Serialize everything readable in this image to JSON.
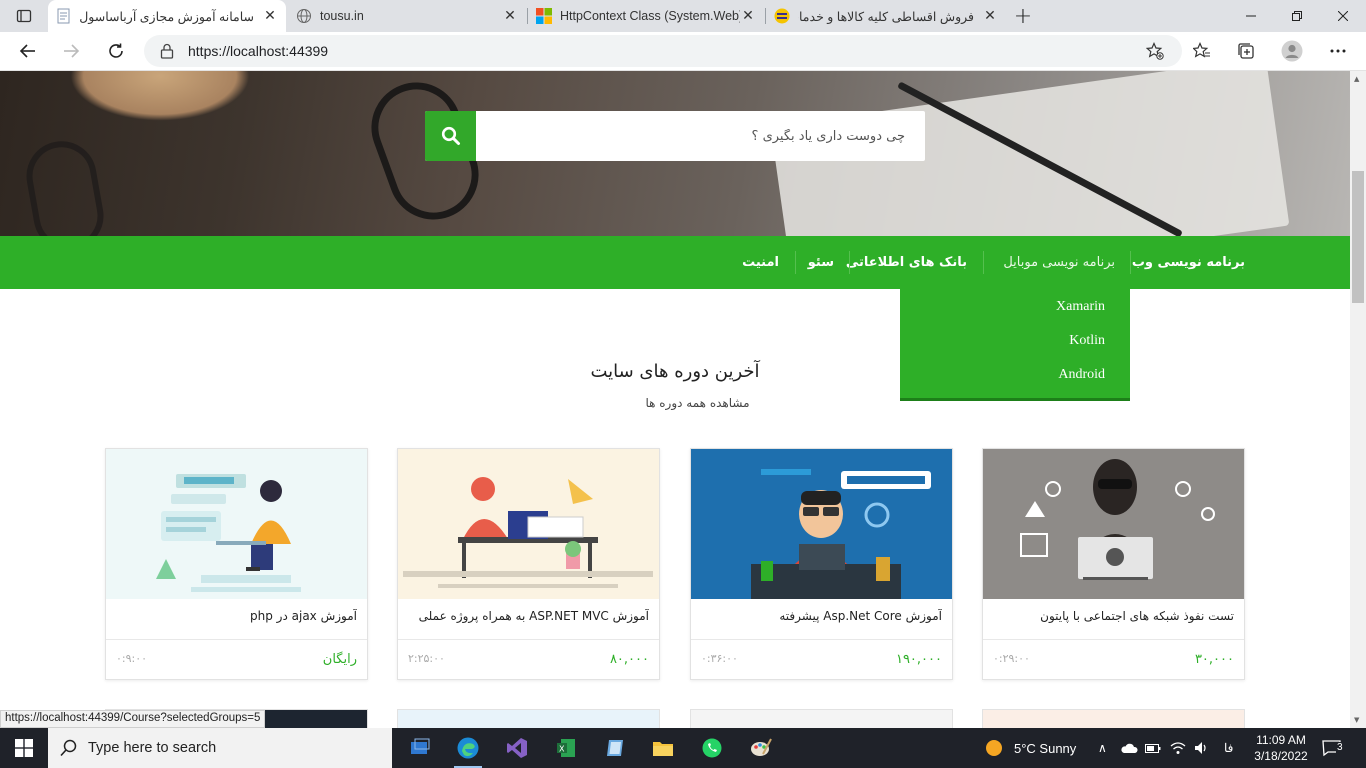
{
  "browser": {
    "tabs": [
      {
        "title": "سامانه آموزش مجازی آرباساسول",
        "active": true
      },
      {
        "title": "tousu.in",
        "active": false
      },
      {
        "title": "HttpContext Class (System.Web)",
        "active": false
      },
      {
        "title": "فروش اقساطی کلیه کالاها و خدمات",
        "active": false
      }
    ],
    "url": "https://localhost:44399",
    "status_url": "https://localhost:44399/Course?selectedGroups=5"
  },
  "site": {
    "search_placeholder": "چی دوست داری یاد بگیری ؟",
    "menu": [
      {
        "label": "برنامه نویسی وب"
      },
      {
        "label": "برنامه نویسی موبایل"
      },
      {
        "label": "بانک های اطلاعاتی"
      },
      {
        "label": "سئو"
      },
      {
        "label": "امنیت"
      }
    ],
    "dropdown": [
      "Xamarin",
      "Kotlin",
      "Android"
    ],
    "section_title": "آخرین دوره های سایت",
    "section_link": "مشاهده همه دوره ها",
    "courses": [
      {
        "title": "تست نفوذ شبکه های اجتماعی با پایتون",
        "price": "۳۰,۰۰۰",
        "duration": "۰:۲۹:۰۰"
      },
      {
        "title": "آموزش Asp.Net Core پیشرفته",
        "price": "۱۹۰,۰۰۰",
        "duration": "۰:۳۶:۰۰"
      },
      {
        "title": "آموزش ASP.NET MVC به همراه پروژه عملی",
        "price": "۸۰,۰۰۰",
        "duration": "۲:۲۵:۰۰"
      },
      {
        "title": "آموزش ajax در php",
        "price": "رایگان",
        "duration": "۰:۹:۰۰"
      }
    ]
  },
  "taskbar": {
    "search_placeholder": "Type here to search",
    "weather": "5°C  Sunny",
    "lang": "فا",
    "time": "11:09 AM",
    "date": "3/18/2022",
    "notifications": "3"
  },
  "colors": {
    "accent": "#2eaf28",
    "accent_dark": "#1d7f19"
  }
}
